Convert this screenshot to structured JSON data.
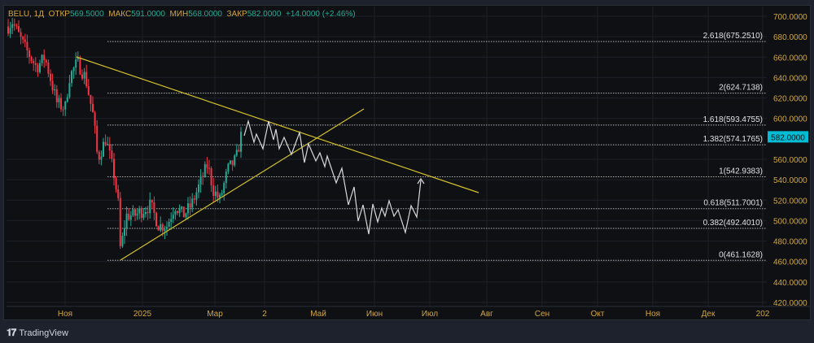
{
  "legend": {
    "symbol": "BELU, 1Д",
    "open_label": "ОТКР",
    "open": "569.5000",
    "high_label": "МАКС",
    "high": "591.0000",
    "low_label": "МИН",
    "low": "568.0000",
    "close_label": "ЗАКР",
    "close": "582.0000",
    "change": "+14.0000 (+2.46%)"
  },
  "footer": {
    "brand": "TradingView"
  },
  "colors": {
    "up": "#22ab94",
    "down": "#f23645",
    "trendline": "#d4c22a",
    "projection": "#d8d8d8",
    "axis_text": "#d1a640",
    "price_tag": "#00bcd4"
  },
  "chart_data": {
    "type": "candlestick",
    "symbol": "BELU",
    "timeframe": "1Д",
    "ylim": [
      420,
      700
    ],
    "y_ticks": [
      "700.0000",
      "680.0000",
      "660.0000",
      "640.0000",
      "620.0000",
      "600.0000",
      "560.0000",
      "540.0000",
      "520.0000",
      "500.0000",
      "480.0000",
      "460.0000",
      "440.0000",
      "420.0000"
    ],
    "y_tick_values": [
      700,
      680,
      660,
      640,
      620,
      600,
      560,
      540,
      520,
      500,
      480,
      460,
      440,
      420
    ],
    "x_ticks": [
      "Ноя",
      "2025",
      "Мар",
      "2",
      "Май",
      "Июн",
      "Июл",
      "Авг",
      "Сен",
      "Окт",
      "Ноя",
      "Дек",
      "202"
    ],
    "last_price": "582.0000",
    "last_price_value": 582,
    "price_keypoints": [
      690,
      695,
      670,
      650,
      660,
      615,
      610,
      640,
      655,
      640,
      600,
      560,
      580,
      545,
      520,
      470,
      505,
      505,
      510,
      515,
      495,
      495,
      515,
      505,
      515,
      535,
      555,
      530,
      520,
      550,
      560,
      590
    ],
    "fibonacci": [
      {
        "label": "2.618(675.2510)",
        "value": 675.251
      },
      {
        "label": "2(624.7138)",
        "value": 624.7138
      },
      {
        "label": "1.618(593.4755)",
        "value": 593.4755
      },
      {
        "label": "1.382(574.1765)",
        "value": 574.1765
      },
      {
        "label": "1(542.9383)",
        "value": 542.9383
      },
      {
        "label": "0.618(511.7001)",
        "value": 511.7001
      },
      {
        "label": "0.382(492.4010)",
        "value": 492.401
      },
      {
        "label": "0(461.1628)",
        "value": 461.1628
      }
    ]
  }
}
